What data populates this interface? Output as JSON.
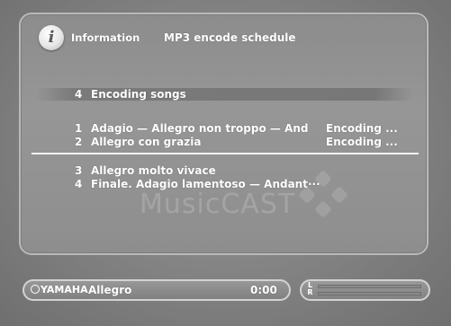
{
  "header": {
    "label": "Information",
    "title": "MP3 encode schedule",
    "icon": "info-icon",
    "icon_glyph": "i"
  },
  "section": {
    "count": "4",
    "title": "Encoding songs"
  },
  "encoding_items": [
    {
      "number": "1",
      "title": "Adagio — Allegro non troppo — And",
      "status": "Encoding ..."
    },
    {
      "number": "2",
      "title": "Allegro con grazia",
      "status": "Encoding ..."
    }
  ],
  "queued_items": [
    {
      "number": "3",
      "title": "Allegro molto vivace"
    },
    {
      "number": "4",
      "title": "Finale. Adagio lamentoso — Andant···"
    }
  ],
  "watermark": "MusicCAST",
  "statusbar": {
    "brand": "YAMAHA",
    "track": "Allegro",
    "time": "0:00"
  },
  "meter": {
    "left_label": "L",
    "right_label": "R",
    "left_level": 0,
    "right_level": 0
  },
  "colors": {
    "text": "#ffffff",
    "background": "#8c8c8c",
    "separator": "#f4f4f4"
  }
}
